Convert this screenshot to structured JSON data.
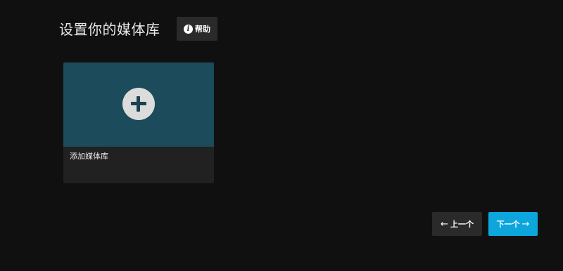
{
  "header": {
    "title": "设置你的媒体库",
    "help_label": "帮助",
    "help_icon": "info-icon"
  },
  "library_card": {
    "label": "添加媒体库",
    "icon": "plus-icon",
    "image_color": "#1c4b5c"
  },
  "navigation": {
    "prev_label": "上一个",
    "prev_icon": "arrow-left-icon",
    "next_label": "下一个",
    "next_icon": "arrow-right-icon",
    "next_color": "#0ca6dd"
  }
}
